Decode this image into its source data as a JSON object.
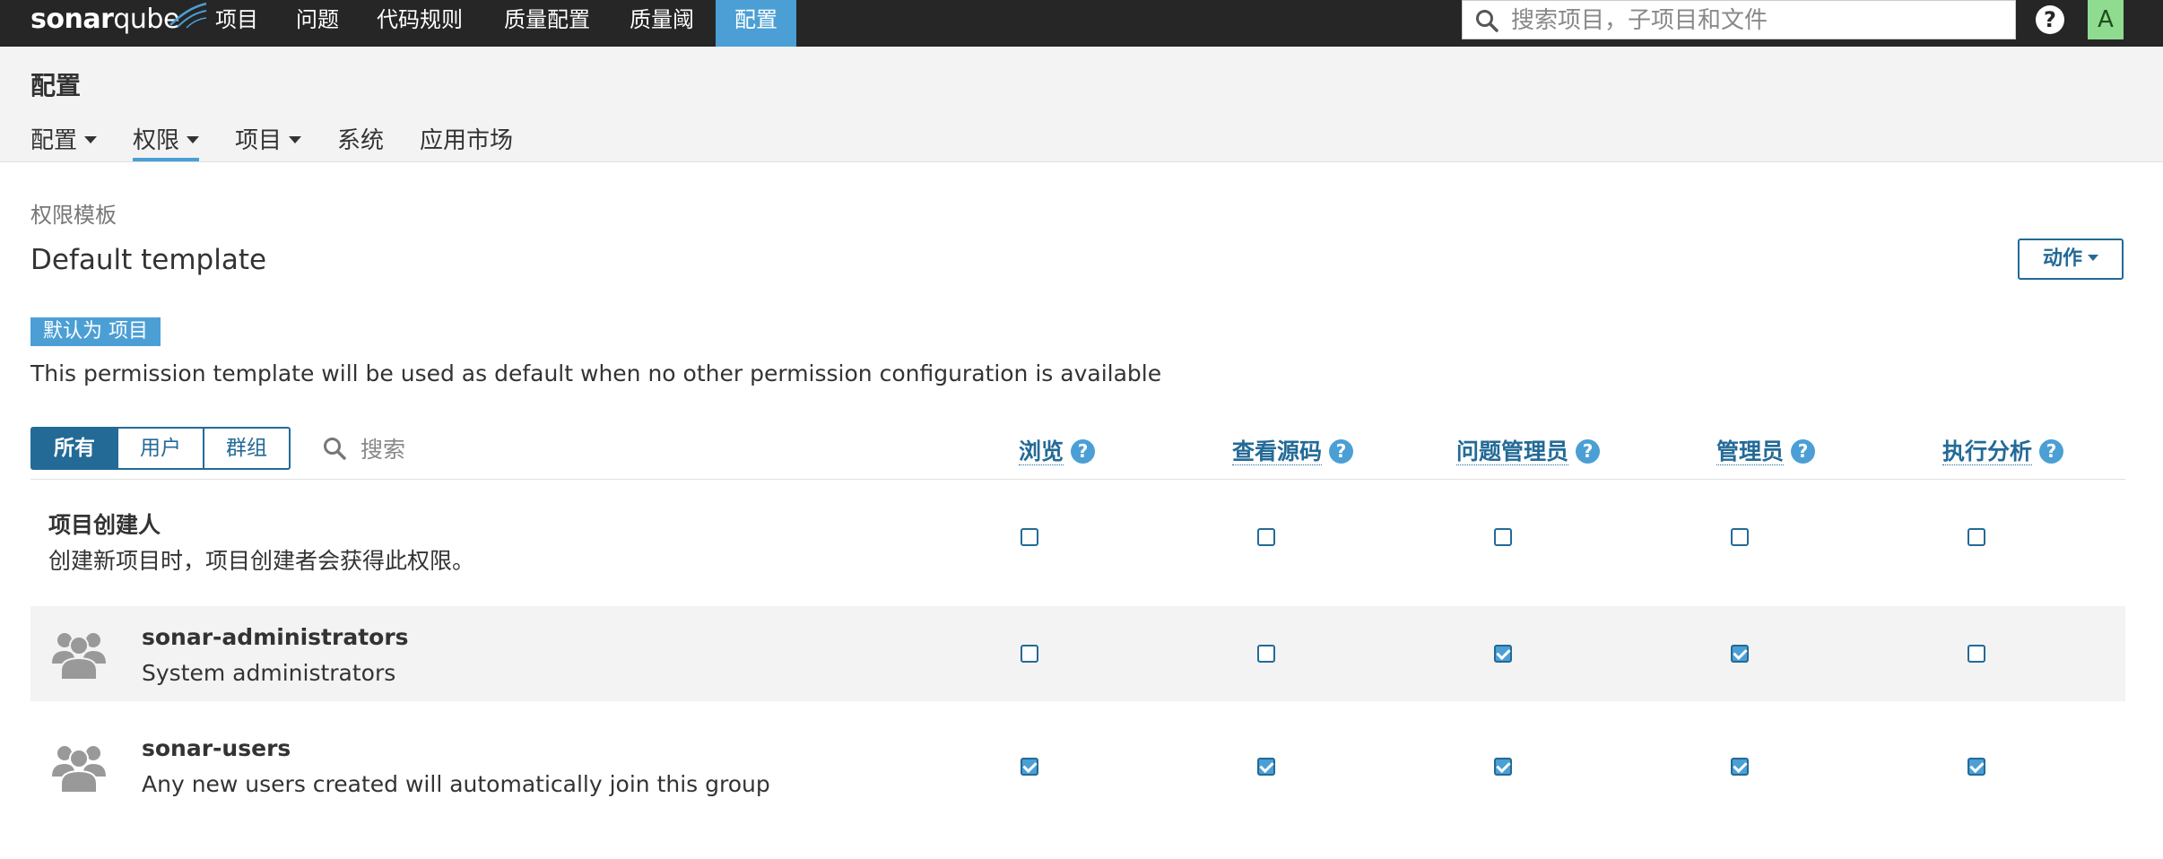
{
  "topbar": {
    "logo_bold": "sonar",
    "logo_thin": "qube",
    "nav": [
      "项目",
      "问题",
      "代码规则",
      "质量配置",
      "质量阈",
      "配置"
    ],
    "active_nav": "配置",
    "search_placeholder": "搜索项目，子项目和文件",
    "help_label": "?",
    "avatar_letter": "A",
    "colors": {
      "bar": "#262626",
      "active": "#4b9fd5",
      "avatar": "#8fdb8f"
    }
  },
  "header": {
    "title": "配置",
    "tabs": [
      {
        "label": "配置",
        "dropdown": true
      },
      {
        "label": "权限",
        "dropdown": true,
        "active": true
      },
      {
        "label": "项目",
        "dropdown": true
      },
      {
        "label": "系统",
        "dropdown": false
      },
      {
        "label": "应用市场",
        "dropdown": false
      }
    ]
  },
  "main": {
    "breadcrumb": "权限模板",
    "template_name": "Default template",
    "actions_label": "动作",
    "default_badge": "默认为 项目",
    "description": "This permission template will be used as default when no other permission configuration is available",
    "filter": {
      "all": "所有",
      "users": "用户",
      "groups": "群组",
      "active": "所有"
    },
    "search_placeholder": "搜索",
    "columns": [
      "浏览",
      "查看源码",
      "问题管理员",
      "管理员",
      "执行分析"
    ],
    "rows": [
      {
        "name": "项目创建人",
        "description": "创建新项目时，项目创建者会获得此权限。",
        "icon": "none",
        "perms": [
          false,
          false,
          false,
          false,
          false
        ]
      },
      {
        "name": "sonar-administrators",
        "description": "System administrators",
        "icon": "group-icon",
        "perms": [
          false,
          false,
          true,
          true,
          false
        ]
      },
      {
        "name": "sonar-users",
        "description": "Any new users created will automatically join this group",
        "icon": "group-icon",
        "perms": [
          true,
          true,
          true,
          true,
          true
        ]
      }
    ],
    "colors": {
      "primary": "#236a97",
      "accent": "#4b9fd5",
      "row_shade": "#f3f3f3"
    }
  }
}
